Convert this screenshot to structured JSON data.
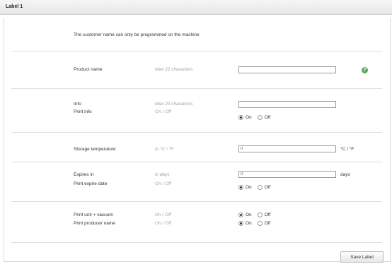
{
  "header": {
    "title": "Label 1"
  },
  "notice": "The customer name can only be programmed on the machine",
  "product_name": {
    "label": "Product name",
    "hint": "Max 22 characters",
    "value": ""
  },
  "info": {
    "label": "Info",
    "hint": "Max 20 characters",
    "value": "",
    "print_label": "Print info",
    "print_hint": "On / Off",
    "options": {
      "on": "On",
      "off": "Off"
    },
    "selected": "on"
  },
  "storage": {
    "label": "Storage temperature",
    "hint": "in °C / °F",
    "value": "0",
    "unit": "°C / °F"
  },
  "expires": {
    "label": "Expires in",
    "hint": "in days",
    "value": "0",
    "unit": "days",
    "print_label": "Print expire date",
    "print_hint": "On / Off",
    "options": {
      "on": "On",
      "off": "Off"
    },
    "selected": "on"
  },
  "vacuum": {
    "label": "Print unit + vacuum",
    "hint": "On / Off",
    "options": {
      "on": "On",
      "off": "Off"
    },
    "selected": "on"
  },
  "producer": {
    "label": "Print producer name",
    "hint": "On / Off",
    "options": {
      "on": "On",
      "off": "Off"
    },
    "selected": "on"
  },
  "save_button": "Save Label",
  "colors": {
    "help_icon": "#5ea85a",
    "header_bg": "#eeeeee",
    "rule": "#dedede"
  }
}
